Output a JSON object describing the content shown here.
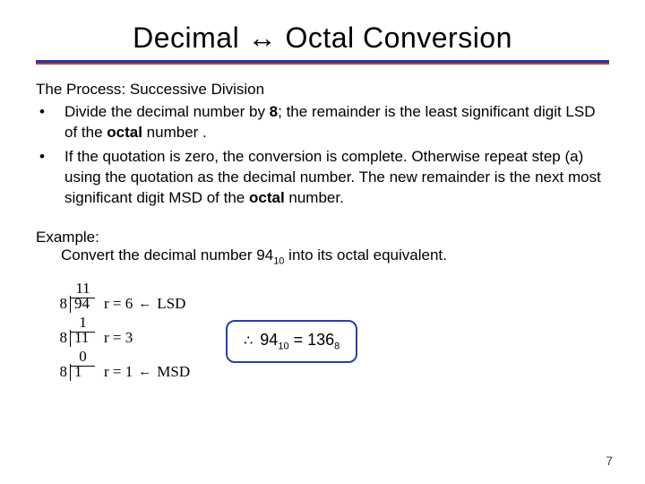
{
  "title": "Decimal ↔ Octal Conversion",
  "process_heading": "The Process: Successive Division",
  "bullets": [
    {
      "pre": "Divide the decimal number by ",
      "bold1": "8",
      "mid": "; the remainder is the least significant digit LSD of the ",
      "bold2": "octal",
      "post": " number ."
    },
    {
      "pre": "If the quotation is zero, the conversion is complete. Otherwise repeat step (a) using the quotation as the decimal number. The new remainder is the next most significant digit MSD of the ",
      "bold1": "octal",
      "mid": " number.",
      "bold2": "",
      "post": ""
    }
  ],
  "example_label": "Example:",
  "example_q_pre": "Convert the decimal number 94",
  "example_q_sub": "10",
  "example_q_post": " into its octal equivalent.",
  "work": [
    {
      "divisor": "8",
      "dividend": "94",
      "quotient": "11",
      "rem_label": "r = 6",
      "tag": "LSD"
    },
    {
      "divisor": "8",
      "dividend": "11",
      "quotient": "1",
      "rem_label": "r = 3",
      "tag": ""
    },
    {
      "divisor": "8",
      "dividend": "1",
      "quotient": "0",
      "rem_label": "r = 1",
      "tag": "MSD"
    }
  ],
  "result": {
    "therefore": "∴",
    "lhs_num": "94",
    "lhs_sub": "10",
    "eq": " = ",
    "rhs_num": "136",
    "rhs_sub": "8"
  },
  "page_number": "7"
}
